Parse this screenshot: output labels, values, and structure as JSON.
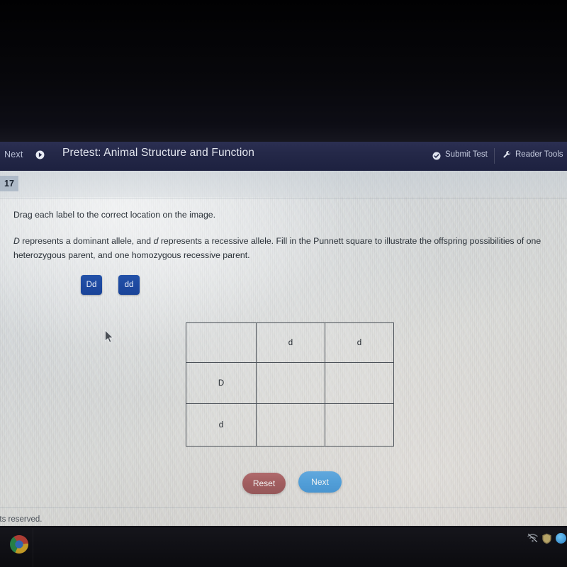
{
  "appbar": {
    "nav_next_label": "Next",
    "nav_next_icon": "arrow-right-circle-icon",
    "title": "Pretest: Animal Structure and Function",
    "submit_label": "Submit Test",
    "submit_icon": "check-circle-icon",
    "reader_label": "Reader Tools",
    "reader_icon": "wrench-icon"
  },
  "question": {
    "number": "17",
    "prompt": "Drag each label to the correct location on the image.",
    "stem_part1": "D",
    "stem_part2": " represents a dominant allele, and ",
    "stem_part3": "d",
    "stem_part4": " represents a recessive allele. Fill in the Punnett square to illustrate the offspring possibilities of one heterozygous parent, and one homozygous recessive parent."
  },
  "tiles": [
    {
      "label": "Dd"
    },
    {
      "label": "dd"
    }
  ],
  "punnett": {
    "rows": [
      [
        "",
        "d",
        "d"
      ],
      [
        "D",
        "",
        ""
      ],
      [
        "d",
        "",
        ""
      ]
    ]
  },
  "buttons": {
    "reset_label": "Reset",
    "next_label": "Next"
  },
  "footer": {
    "text": "nts reserved."
  },
  "taskbar": {
    "chrome_icon": "chrome-icon",
    "network_icon": "network-muted-icon",
    "shield_icon": "shield-icon",
    "avatar_icon": "user-avatar-icon"
  },
  "colors": {
    "appbar": "#242848",
    "tile": "#1d49a0",
    "reset": "#a15d5f",
    "next": "#529fd8",
    "grid_line": "#4c5259"
  }
}
